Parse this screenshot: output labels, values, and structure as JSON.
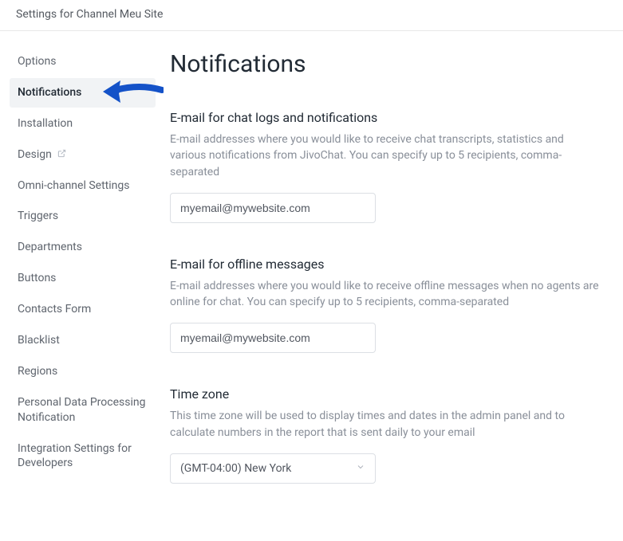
{
  "header": {
    "title": "Settings for Channel Meu Site"
  },
  "sidebar": {
    "items": [
      {
        "label": "Options"
      },
      {
        "label": "Notifications"
      },
      {
        "label": "Installation"
      },
      {
        "label": "Design",
        "ext": true
      },
      {
        "label": "Omni-channel Settings"
      },
      {
        "label": "Triggers"
      },
      {
        "label": "Departments"
      },
      {
        "label": "Buttons"
      },
      {
        "label": "Contacts Form"
      },
      {
        "label": "Blacklist"
      },
      {
        "label": "Regions"
      },
      {
        "label": "Personal Data Processing Notification"
      },
      {
        "label": "Integration Settings for Developers"
      }
    ]
  },
  "main": {
    "title": "Notifications",
    "sections": {
      "chatlogs": {
        "title": "E-mail for chat logs and notifications",
        "desc": "E-mail addresses where you would like to receive chat transcripts, statistics and various notifications from JivoChat. You can specify up to 5 recipients, comma-separated",
        "value": "myemail@mywebsite.com"
      },
      "offline": {
        "title": "E-mail for offline messages",
        "desc": "E-mail addresses where you would like to receive offline messages when no agents are online for chat. You can specify up to 5 recipients, comma-separated",
        "value": "myemail@mywebsite.com"
      },
      "timezone": {
        "title": "Time zone",
        "desc": "This time zone will be used to display times and dates in the admin panel and to calculate numbers in the report that is sent daily to your email",
        "value": "(GMT-04:00) New York"
      }
    }
  }
}
